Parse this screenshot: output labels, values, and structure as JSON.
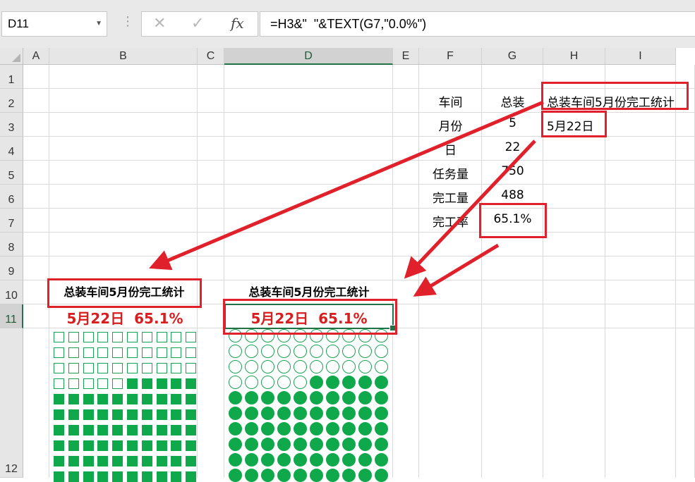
{
  "formula_bar": {
    "name_box": "D11",
    "formula": "=H3&\"  \"&TEXT(G7,\"0.0%\")",
    "fx_label": "fx"
  },
  "columns": [
    "A",
    "B",
    "C",
    "D",
    "E",
    "F",
    "G",
    "H",
    "I"
  ],
  "rows": [
    "1",
    "2",
    "3",
    "4",
    "5",
    "6",
    "7",
    "8",
    "9",
    "10",
    "11",
    "12"
  ],
  "selected_cell": {
    "column": "D",
    "row": "11"
  },
  "table": [
    {
      "label": "车间",
      "value": "总装"
    },
    {
      "label": "月份",
      "value": "5"
    },
    {
      "label": "日",
      "value": "22"
    },
    {
      "label": "任务量",
      "value": "750"
    },
    {
      "label": "完工量",
      "value": "488"
    },
    {
      "label": "完工率",
      "value": "65.1%"
    }
  ],
  "h2": "总装车间5月份完工统计",
  "h3": "5月22日",
  "chart_title_b": "总装车间5月份完工统计",
  "chart_title_d": "总装车间5月份完工统计",
  "result_b": "5月22日  65.1%",
  "result_d": "5月22日  65.1%",
  "progress": {
    "completion_rate": 0.651,
    "cells_total": 100,
    "cells_filled": 65
  },
  "colors": {
    "fill": "#0fa94c",
    "highlight": "#e0202a",
    "result_text": "#d81e1e",
    "selected": "#217346"
  }
}
